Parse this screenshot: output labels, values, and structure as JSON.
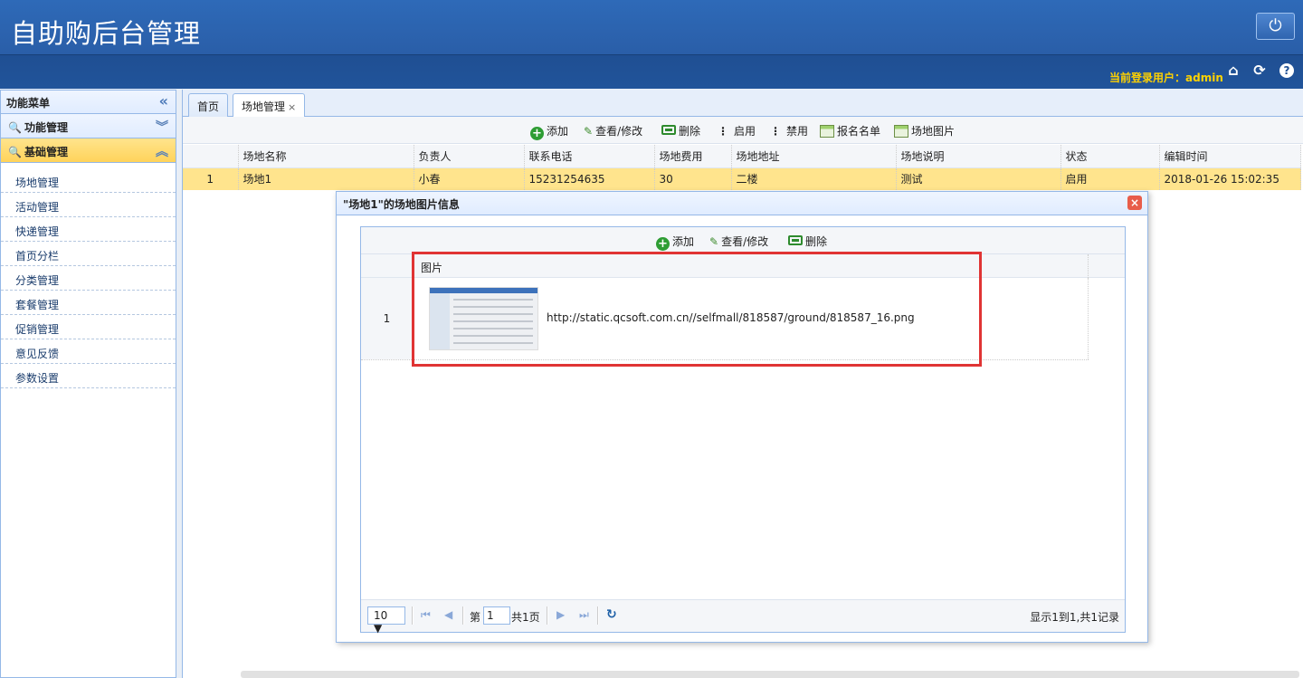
{
  "header": {
    "app_title": "自助购后台管理",
    "power_icon": "⏻",
    "user_prefix": "当前登录用户：",
    "username": "admin",
    "home_icon": "⌂",
    "refresh_icon": "⟳",
    "help_icon": "?"
  },
  "sidebar": {
    "title": "功能菜单",
    "collapse_icon": "«",
    "sections": [
      {
        "label": "功能管理",
        "arrow": "︾"
      },
      {
        "label": "基础管理",
        "arrow": "︽"
      }
    ],
    "search_icon": "🔍",
    "items": [
      "场地管理",
      "活动管理",
      "快递管理",
      "首页分栏",
      "分类管理",
      "套餐管理",
      "促销管理",
      "意见反馈",
      "参数设置"
    ]
  },
  "tabs": {
    "home": "首页",
    "current": "场地管理",
    "close": "×"
  },
  "toolbar": {
    "add": "添加",
    "edit": "查看/修改",
    "delete": "删除",
    "enable": "启用",
    "disable": "禁用",
    "signup_list": "报名名单",
    "venue_images": "场地图片"
  },
  "table": {
    "columns": [
      "场地名称",
      "负责人",
      "联系电话",
      "场地费用",
      "场地地址",
      "场地说明",
      "状态",
      "编辑时间"
    ],
    "rows": [
      {
        "num": "1",
        "cells": [
          "场地1",
          "小春",
          "15231254635",
          "30",
          "二楼",
          "测试",
          "启用",
          "2018-01-26 15:02:35"
        ]
      }
    ]
  },
  "dialog": {
    "title": "\"场地1\"的场地图片信息",
    "close": "×",
    "toolbar": {
      "add": "添加",
      "edit": "查看/修改",
      "delete": "删除"
    },
    "column": "图片",
    "row_num": "1",
    "image_url": "http://static.qcsoft.com.cn//selfmall/818587/ground/818587_16.png",
    "pager": {
      "page_size": "10 ▼",
      "first": "⏮",
      "prev": "◀",
      "page_prefix": "第",
      "page": "1",
      "page_suffix": "共1页",
      "next": "▶",
      "last": "⏭",
      "refresh": "↻",
      "summary": "显示1到1,共1记录"
    }
  }
}
